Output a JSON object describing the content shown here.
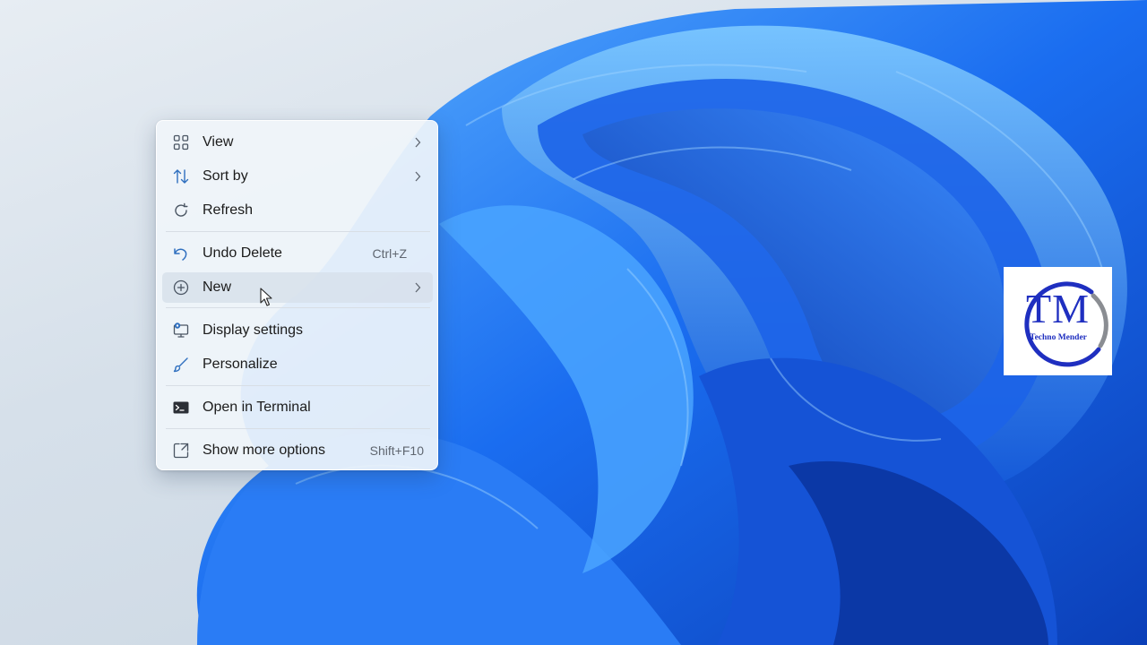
{
  "colors": {
    "wallpaper_bg": "#d6e0ea",
    "bloom_blue": "#1a6df0",
    "menu_bg": "#eef3f8",
    "accent_icon": "#2f6fbf",
    "logo_blue": "#1f2fc0",
    "logo_gray": "#8a8d92"
  },
  "context_menu": {
    "items": [
      {
        "label": "View",
        "icon": "grid-icon",
        "submenu": true,
        "shortcut": ""
      },
      {
        "label": "Sort by",
        "icon": "sort-arrows-icon",
        "submenu": true,
        "shortcut": ""
      },
      {
        "label": "Refresh",
        "icon": "refresh-icon",
        "submenu": false,
        "shortcut": ""
      },
      {
        "label": "Undo Delete",
        "icon": "undo-icon",
        "submenu": false,
        "shortcut": "Ctrl+Z"
      },
      {
        "label": "New",
        "icon": "plus-circle-icon",
        "submenu": true,
        "shortcut": "",
        "highlighted": true
      },
      {
        "label": "Display settings",
        "icon": "display-settings-icon",
        "submenu": false,
        "shortcut": ""
      },
      {
        "label": "Personalize",
        "icon": "brush-icon",
        "submenu": false,
        "shortcut": ""
      },
      {
        "label": "Open in Terminal",
        "icon": "terminal-icon",
        "submenu": false,
        "shortcut": ""
      },
      {
        "label": "Show more options",
        "icon": "expand-icon",
        "submenu": false,
        "shortcut": "Shift+F10"
      }
    ]
  },
  "watermark": {
    "initials": "TM",
    "name": "Techno Mender"
  }
}
